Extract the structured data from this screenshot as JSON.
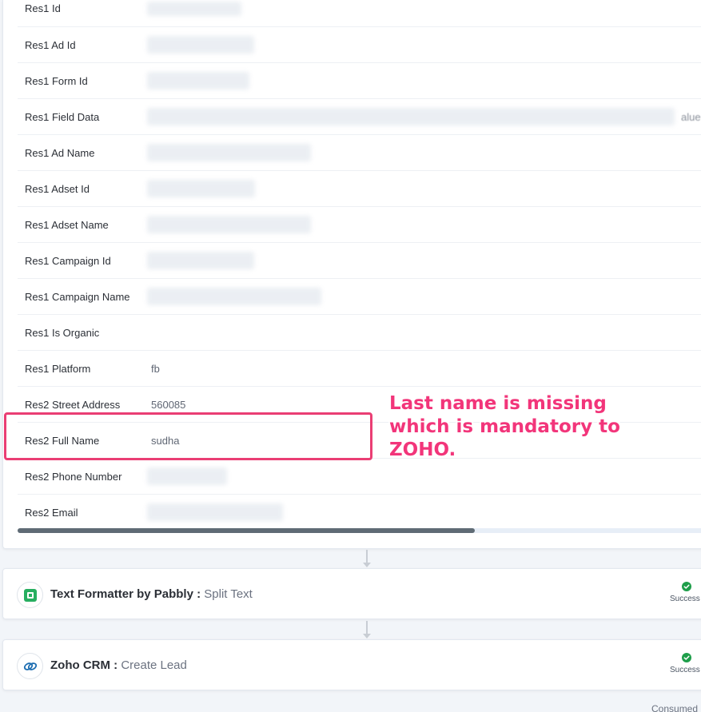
{
  "rows": [
    {
      "label": "Res1 Id",
      "value": "",
      "redacted": true
    },
    {
      "label": "Res1 Ad Id",
      "value": "",
      "redacted": true
    },
    {
      "label": "Res1 Form Id",
      "value": "",
      "redacted": true
    },
    {
      "label": "Res1 Field Data",
      "value": "",
      "redacted": true,
      "tail": "alue"
    },
    {
      "label": "Res1 Ad Name",
      "value": "",
      "redacted": true
    },
    {
      "label": "Res1 Adset Id",
      "value": "",
      "redacted": true
    },
    {
      "label": "Res1 Adset Name",
      "value": "",
      "redacted": true
    },
    {
      "label": "Res1 Campaign Id",
      "value": "",
      "redacted": true
    },
    {
      "label": "Res1 Campaign Name",
      "value": "",
      "redacted": true
    },
    {
      "label": "Res1 Is Organic",
      "value": ""
    },
    {
      "label": "Res1 Platform",
      "value": "fb"
    },
    {
      "label": "Res2 Street Address",
      "value": "560085"
    },
    {
      "label": "Res2 Full Name",
      "value": "sudha"
    },
    {
      "label": "Res2 Phone Number",
      "value": "",
      "redacted": true
    },
    {
      "label": "Res2 Email",
      "value": "",
      "redacted": true
    }
  ],
  "annotation": {
    "lines": [
      "Last name is missing",
      "which is mandatory to",
      "ZOHO."
    ],
    "color": "#f2357a"
  },
  "steps": [
    {
      "app": "Text Formatter by Pabbly :",
      "action": "Split Text",
      "status": "Success",
      "icon": "text-formatter-icon"
    },
    {
      "app": "Zoho CRM :",
      "action": "Create Lead",
      "status": "Success",
      "icon": "zoho-crm-icon"
    }
  ],
  "footer": {
    "text": "Consumed"
  },
  "colors": {
    "success": "#1e9e4a",
    "highlight": "#ea3e74",
    "formatter_green": "#27ae60",
    "zoho_blue": "#1f6fb2"
  }
}
